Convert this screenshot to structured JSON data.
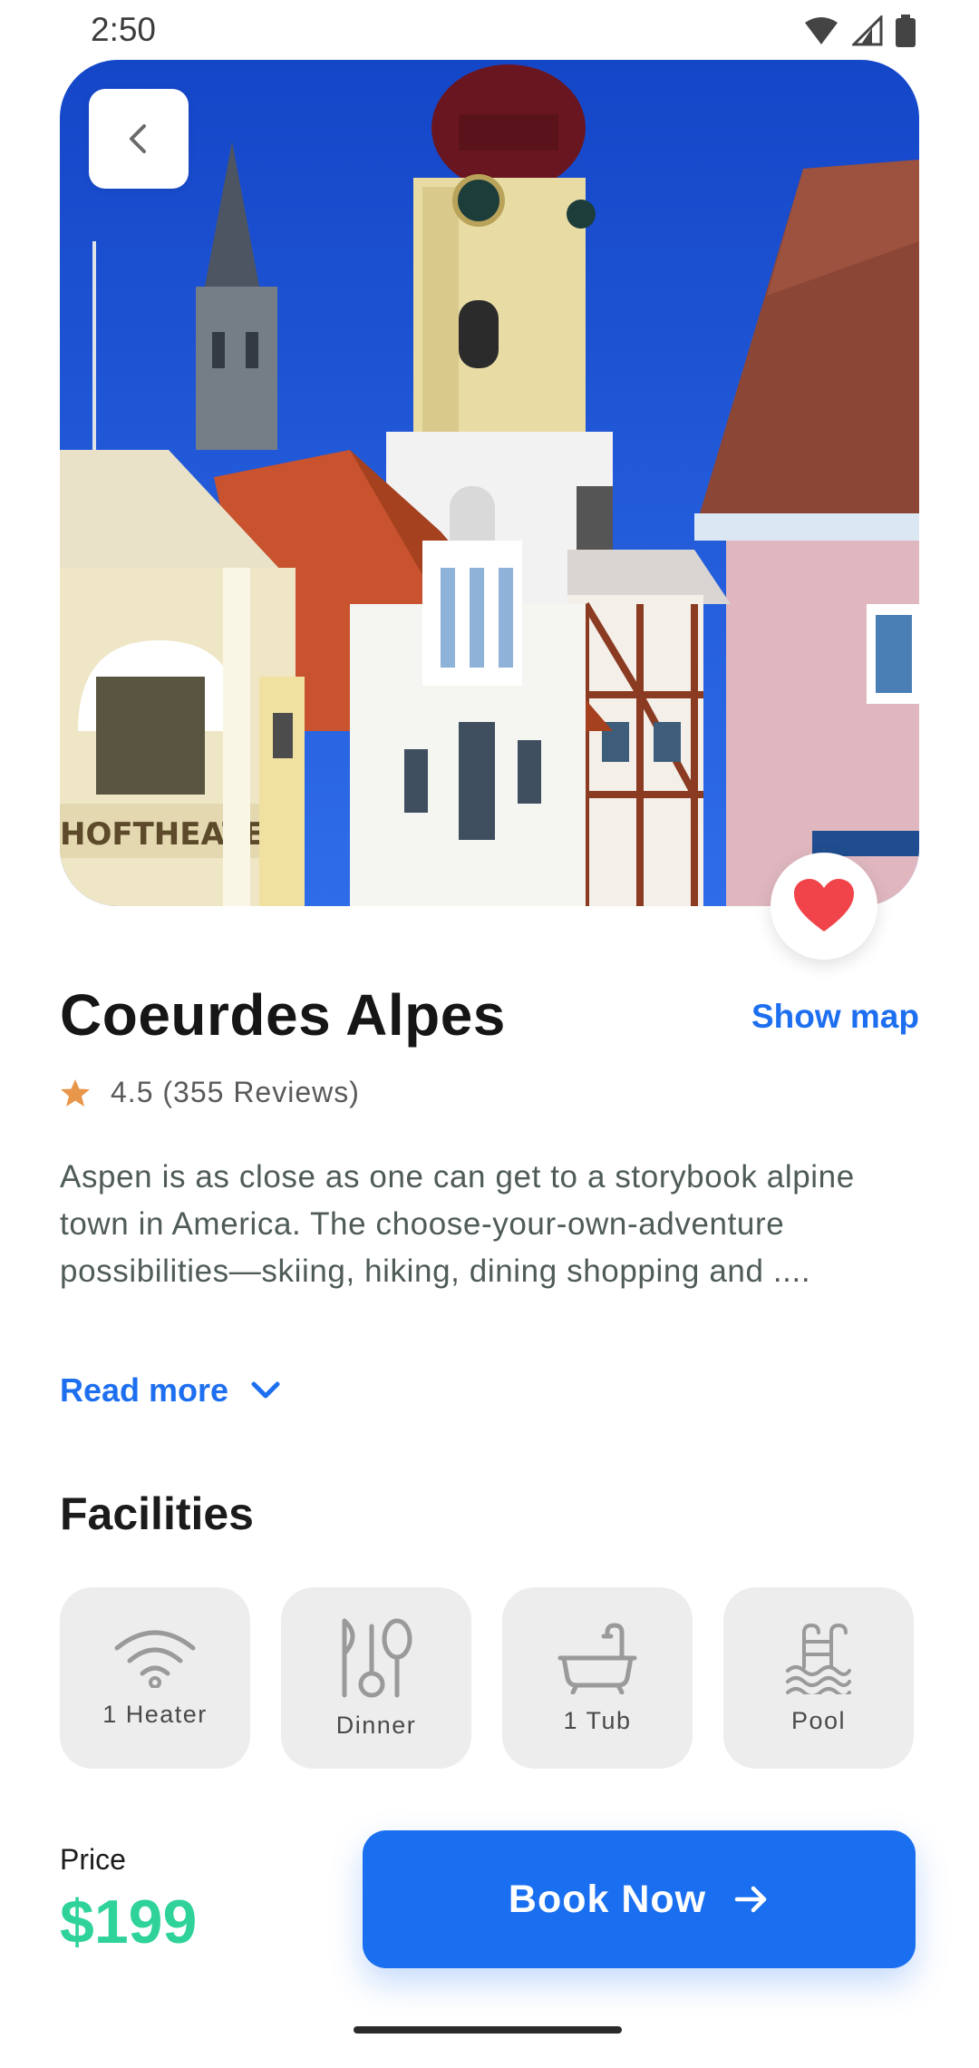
{
  "status_bar": {
    "time": "2:50"
  },
  "hotel": {
    "name": "Coeurdes Alpes",
    "show_map_label": "Show map",
    "rating": "4.5 (355 Reviews)",
    "description": "Aspen is as close as one can get to a storybook alpine town in America. The choose-your-own-adventure possibilities—skiing, hiking, dining shopping and ....",
    "read_more_label": "Read more"
  },
  "facilities": {
    "title": "Facilities",
    "items": [
      {
        "label": "1 Heater",
        "icon": "wifi-icon"
      },
      {
        "label": "Dinner",
        "icon": "dinner-icon"
      },
      {
        "label": "1 Tub",
        "icon": "bathtub-icon"
      },
      {
        "label": "Pool",
        "icon": "pool-icon"
      }
    ]
  },
  "booking": {
    "price_label": "Price",
    "price": "$199",
    "book_label": "Book Now"
  },
  "colors": {
    "accent": "#1a6ff0",
    "price": "#2fd39a",
    "favorite": "#f0444a",
    "star": "#e8964a"
  }
}
